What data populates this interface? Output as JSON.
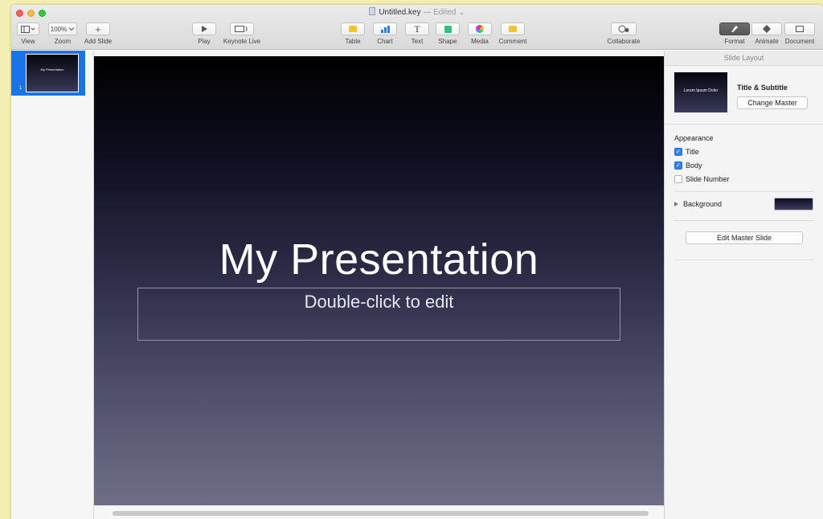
{
  "window": {
    "title": "Untitled.key",
    "status": "— Edited ⌄"
  },
  "toolbar": {
    "view_label": "View",
    "zoom_value": "100%",
    "zoom_label": "Zoom",
    "add_slide_label": "Add Slide",
    "play_label": "Play",
    "keynote_live_label": "Keynote Live",
    "table_label": "Table",
    "chart_label": "Chart",
    "text_label": "Text",
    "text_glyph": "T",
    "shape_label": "Shape",
    "media_label": "Media",
    "comment_label": "Comment",
    "collaborate_label": "Collaborate",
    "format_label": "Format",
    "animate_label": "Animate",
    "document_label": "Document",
    "add_glyph": "+",
    "colors": {
      "table": "#f7c326",
      "chart": "#2f7de1",
      "shape": "#33c07a",
      "comment": "#f3c428"
    }
  },
  "navigator": {
    "slides": [
      {
        "number": "1",
        "thumb_text": "My Presentation"
      }
    ]
  },
  "slide": {
    "title": "My Presentation",
    "subtitle": "Double-click to edit"
  },
  "inspector": {
    "header": "Slide Layout",
    "master_thumb_text": "Lorem Ipsum Dolor",
    "master_name": "Title & Subtitle",
    "change_master": "Change Master",
    "appearance": "Appearance",
    "options": [
      {
        "label": "Title",
        "checked": true
      },
      {
        "label": "Body",
        "checked": true
      },
      {
        "label": "Slide Number",
        "checked": false
      }
    ],
    "background_label": "Background",
    "edit_master": "Edit Master Slide"
  }
}
